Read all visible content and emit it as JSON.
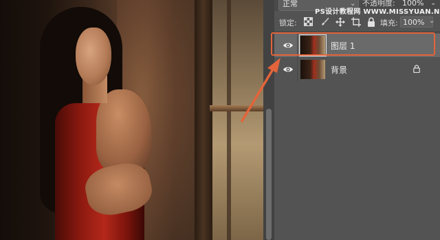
{
  "blend_mode": "正常",
  "opacity": {
    "label": "不透明度:",
    "value": "100%"
  },
  "lock": {
    "label": "锁定:"
  },
  "fill": {
    "label": "填充:",
    "value": "100%"
  },
  "watermark": "PS设计教程网 WWW.MISSYUAN.NET",
  "layers": [
    {
      "name": "图层 1",
      "visible": true,
      "selected": true,
      "locked": false
    },
    {
      "name": "背景",
      "visible": true,
      "selected": false,
      "locked": true
    }
  ],
  "colors": {
    "panel_bg": "#535353",
    "selected_row": "#6a6a6a",
    "highlight": "#e3643b",
    "arrow": "#e3643b"
  },
  "icons": [
    "eye-icon",
    "lock-transparent-icon",
    "brush-icon",
    "move-icon",
    "artboard-icon",
    "lock-all-icon",
    "padlock-icon",
    "chevron-down-icon"
  ]
}
